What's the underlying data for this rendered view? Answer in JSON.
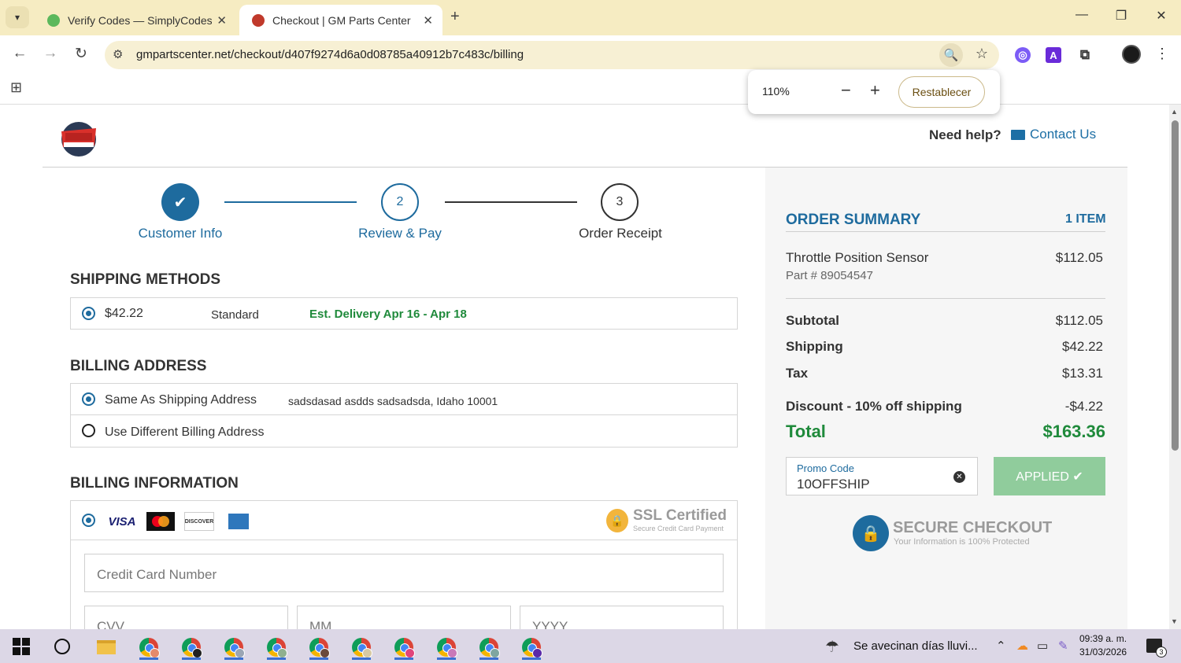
{
  "browser": {
    "tabs": [
      {
        "title": "Verify Codes — SimplyCodes",
        "active": false
      },
      {
        "title": "Checkout | GM Parts Center",
        "active": true
      }
    ],
    "url": "gmpartscenter.net/checkout/d407f9274d6a0d08785a40912b7c483c/billing",
    "zoom": {
      "value": "110%",
      "reset_label": "Restablecer"
    }
  },
  "header": {
    "help_text": "Need help?",
    "contact_label": "Contact Us"
  },
  "steps": [
    {
      "number": "",
      "label": "Customer Info",
      "state": "done"
    },
    {
      "number": "2",
      "label": "Review & Pay",
      "state": "current"
    },
    {
      "number": "3",
      "label": "Order Receipt",
      "state": "pending"
    }
  ],
  "shipping": {
    "title": "SHIPPING METHODS",
    "price": "$42.22",
    "method": "Standard",
    "delivery": "Est. Delivery Apr 16 - Apr 18"
  },
  "billing_address": {
    "title": "BILLING ADDRESS",
    "same_label": "Same As Shipping Address",
    "address": "sadsdasad asdds sadsadsda, Idaho 10001",
    "different_label": "Use Different Billing Address"
  },
  "billing_info": {
    "title": "BILLING INFORMATION",
    "cards": [
      "VISA",
      "Mastercard",
      "DISCOVER",
      "AMEX"
    ],
    "ssl_title": "SSL Certified",
    "ssl_sub": "Secure Credit Card Payment",
    "card_number_placeholder": "Credit Card Number",
    "cvv_placeholder": "CVV",
    "mm_placeholder": "MM",
    "yyyy_placeholder": "YYYY"
  },
  "order_summary": {
    "title": "ORDER SUMMARY",
    "count": "1 ITEM",
    "item_name": "Throttle Position Sensor",
    "item_price": "$112.05",
    "item_part": "Part # 89054547",
    "subtotal_label": "Subtotal",
    "subtotal": "$112.05",
    "shipping_label": "Shipping",
    "shipping": "$42.22",
    "tax_label": "Tax",
    "tax": "$13.31",
    "discount_label": "Discount - 10% off shipping",
    "discount": "-$4.22",
    "total_label": "Total",
    "total": "$163.36",
    "promo_label": "Promo Code",
    "promo_value": "10OFFSHIP",
    "applied_label": "APPLIED ✔",
    "secure_title": "SECURE CHECKOUT",
    "secure_sub": "Your Information is 100% Protected"
  },
  "taskbar": {
    "weather": "Se avecinan días lluvi...",
    "time": "09:39 a. m.",
    "date": "31/03/2026",
    "notifications": "3"
  },
  "colors": {
    "brand_blue": "#1e6b9e",
    "total_green": "#1f8a3b",
    "applied_green": "#90cc9c",
    "chrome_bg": "#f6ecc2"
  }
}
